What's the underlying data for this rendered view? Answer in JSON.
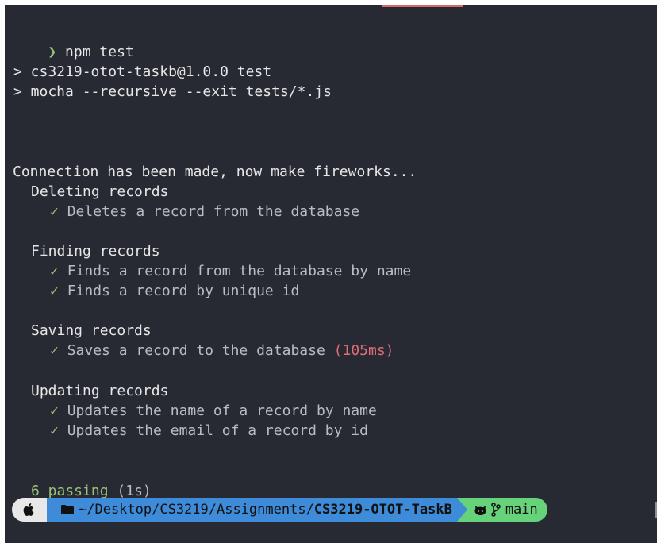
{
  "terminal": {
    "prompt_symbol": "❯",
    "command": "npm test",
    "script_lines": [
      "> cs3219-otot-taskb@1.0.0 test",
      "> mocha --recursive --exit tests/*.js"
    ],
    "connection_message": "Connection has been made, now make fireworks...",
    "check_mark": "✓",
    "suites": [
      {
        "title": "Deleting records",
        "tests": [
          {
            "name": "Deletes a record from the database",
            "duration": ""
          }
        ]
      },
      {
        "title": "Finding records",
        "tests": [
          {
            "name": "Finds a record from the database by name",
            "duration": ""
          },
          {
            "name": "Finds a record by unique id",
            "duration": ""
          }
        ]
      },
      {
        "title": "Saving records",
        "tests": [
          {
            "name": "Saves a record to the database",
            "duration": "(105ms)"
          }
        ]
      },
      {
        "title": "Updating records",
        "tests": [
          {
            "name": "Updates the name of a record by name",
            "duration": ""
          },
          {
            "name": "Updates the email of a record by id",
            "duration": ""
          }
        ]
      }
    ],
    "summary": {
      "passing": "6 passing",
      "time": "(1s)"
    }
  },
  "status_bar": {
    "path_prefix": "~/Desktop/CS3219/Assignments/",
    "path_current": "CS3219-OTOT-TaskB",
    "branch": "main"
  },
  "colors": {
    "background": "#272a32",
    "success": "#98c379",
    "error": "#e06c75",
    "path_segment": "#3d8bd9",
    "git_segment": "#66d27a"
  }
}
